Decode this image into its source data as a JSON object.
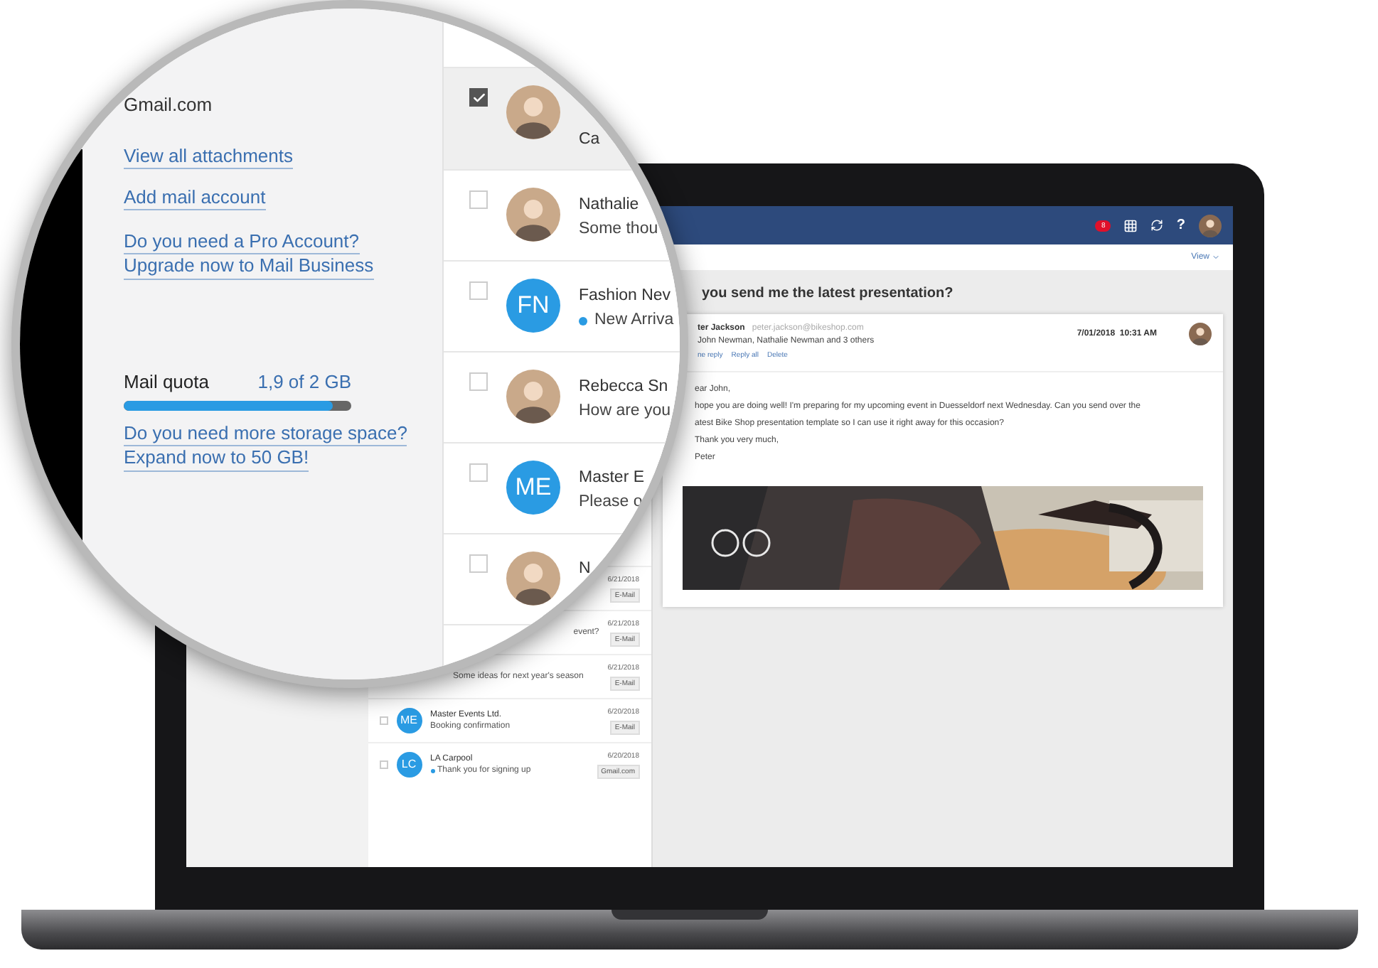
{
  "magnifier": {
    "sidebar": {
      "account": "Gmail.com",
      "links": [
        "View all attachments",
        "Add mail account"
      ],
      "upgrade_links": [
        "Do you need a Pro Account?",
        "Upgrade now to Mail Business"
      ],
      "quota": {
        "label": "Mail quota",
        "reading": "1,9 of 2 GB",
        "level": 0.92
      },
      "storage_links": [
        "Do you need more storage space?",
        "Expand now to 50 GB!"
      ]
    },
    "messages": [
      {
        "selected": true,
        "checked": true,
        "unread": false,
        "sender": "Ca"
      },
      {
        "selected": false,
        "checked": false,
        "unread": false,
        "sender": "Nathalie",
        "preview": "Some thou"
      },
      {
        "kind": "initials",
        "selected": false,
        "checked": false,
        "unread": true,
        "initials": "FN",
        "sender": "Fashion Nev",
        "preview": "New Arriva"
      },
      {
        "selected": false,
        "checked": false,
        "unread": false,
        "sender": "Rebecca Sn",
        "preview": "How are you"
      },
      {
        "kind": "initials",
        "selected": false,
        "checked": false,
        "unread": false,
        "initials": "ME",
        "sender": "Master E",
        "preview": "Please o"
      },
      {
        "selected": false,
        "checked": false,
        "unread": false,
        "sender": "N"
      }
    ]
  },
  "mail_list": [
    {
      "kind": "partial",
      "date": "6/21/2018",
      "tag": "E-Mail"
    },
    {
      "kind": "tail",
      "preview": "event?",
      "date": "6/21/2018",
      "tag": "E-Mail"
    },
    {
      "kind": "partial",
      "preview": "Some ideas for next year's season",
      "date": "6/21/2018",
      "tag": "E-Mail"
    },
    {
      "kind": "full",
      "checked": false,
      "unread": false,
      "initials": "ME",
      "sender": "Master Events Ltd.",
      "preview": "Booking confirmation",
      "date": "6/20/2018",
      "tag": "E-Mail"
    },
    {
      "kind": "full",
      "checked": false,
      "unread": true,
      "initials": "LC",
      "sender": "LA Carpool",
      "preview": "Thank you for signing up",
      "date": "6/20/2018",
      "tag": "Gmail.com"
    }
  ],
  "header": {
    "badge": "8",
    "help": "?"
  },
  "view_menu": "View",
  "message": {
    "subject": "you send me the latest presentation?",
    "sender": "ter Jackson",
    "email": "peter.jackson@bikeshop.com",
    "recipients": "John Newman, Nathalie Newman and 3 others",
    "actions": [
      "ne reply",
      "Reply all",
      "Delete"
    ],
    "date": "7/01/2018  10:31 AM",
    "body": [
      "ear John,",
      "hope you are doing well! I'm preparing for my upcoming event in Duesseldorf next Wednesday. Can you send over the",
      "atest Bike Shop presentation template so I can use it right away for this occasion?",
      "Thank you very much,",
      "Peter"
    ],
    "attachment": {
      "kind": "picture"
    }
  }
}
